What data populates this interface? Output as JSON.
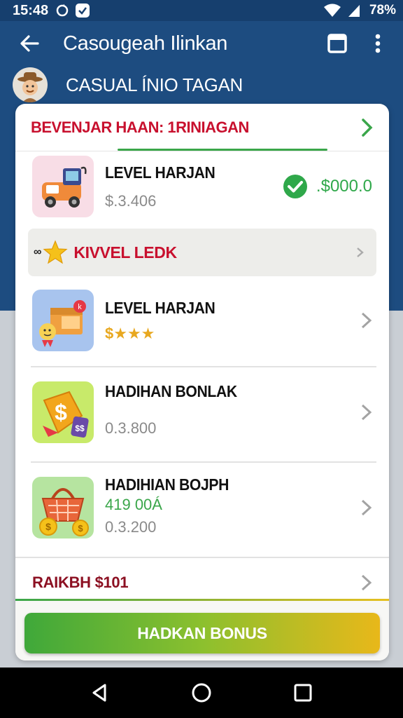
{
  "status_bar": {
    "time": "15:48",
    "battery": "78%"
  },
  "toolbar": {
    "title": "Casougeah Ilinkan"
  },
  "profile": {
    "name": "CASUAL ÍNIO TAGAN"
  },
  "card": {
    "header_title": "BEVENJAR HAAN: 1RINIAGAN",
    "items": [
      {
        "title": "LEVEL HARJAN",
        "subtitle": "$.3.406",
        "amount": ".$000.0"
      },
      {
        "title": "KIVVEL LEDK"
      },
      {
        "title": "LEVEL HARJAN",
        "subtitle": "$★★★"
      },
      {
        "title": "HADIHAN BONLAK",
        "subtitle": "0.3.800"
      },
      {
        "title": "HADIHIAN BOJPH",
        "subtitle_green": "419 00Á",
        "subtitle": "0.3.200"
      }
    ],
    "footer_title": "RAIKBH $101",
    "cta_label": "HADKAN BONUS"
  },
  "colors": {
    "primary": "#1d4c80",
    "accent_red": "#c8102e",
    "accent_green": "#3aa64a",
    "accent_gold": "#e8b81a"
  }
}
